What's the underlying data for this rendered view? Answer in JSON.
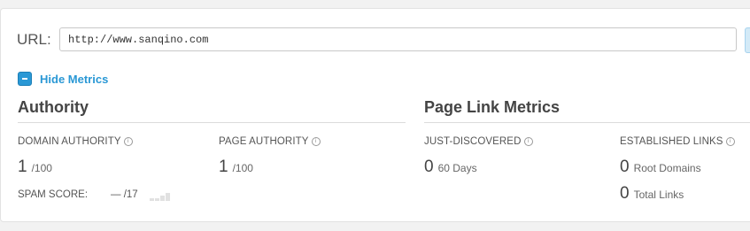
{
  "url_bar": {
    "label": "URL:",
    "value": "http://www.sanqino.com"
  },
  "metrics_toggle": {
    "label": "Hide Metrics",
    "icon": "collapse-minus-icon",
    "color": "#2a98d5"
  },
  "authority": {
    "title": "Authority",
    "domain_authority": {
      "label": "DOMAIN AUTHORITY",
      "value": "1",
      "suffix": "/100"
    },
    "page_authority": {
      "label": "PAGE AUTHORITY",
      "value": "1",
      "suffix": "/100"
    },
    "spam_score": {
      "label": "SPAM SCORE:",
      "value": "— /17"
    }
  },
  "page_link_metrics": {
    "title": "Page Link Metrics",
    "just_discovered": {
      "label": "JUST-DISCOVERED",
      "value": "0",
      "suffix": "60 Days"
    },
    "established_links": {
      "label": "ESTABLISHED LINKS",
      "root_domains": {
        "value": "0",
        "suffix": "Root Domains"
      },
      "total_links": {
        "value": "0",
        "suffix": "Total Links"
      }
    }
  },
  "info_icon_glyph": "i"
}
